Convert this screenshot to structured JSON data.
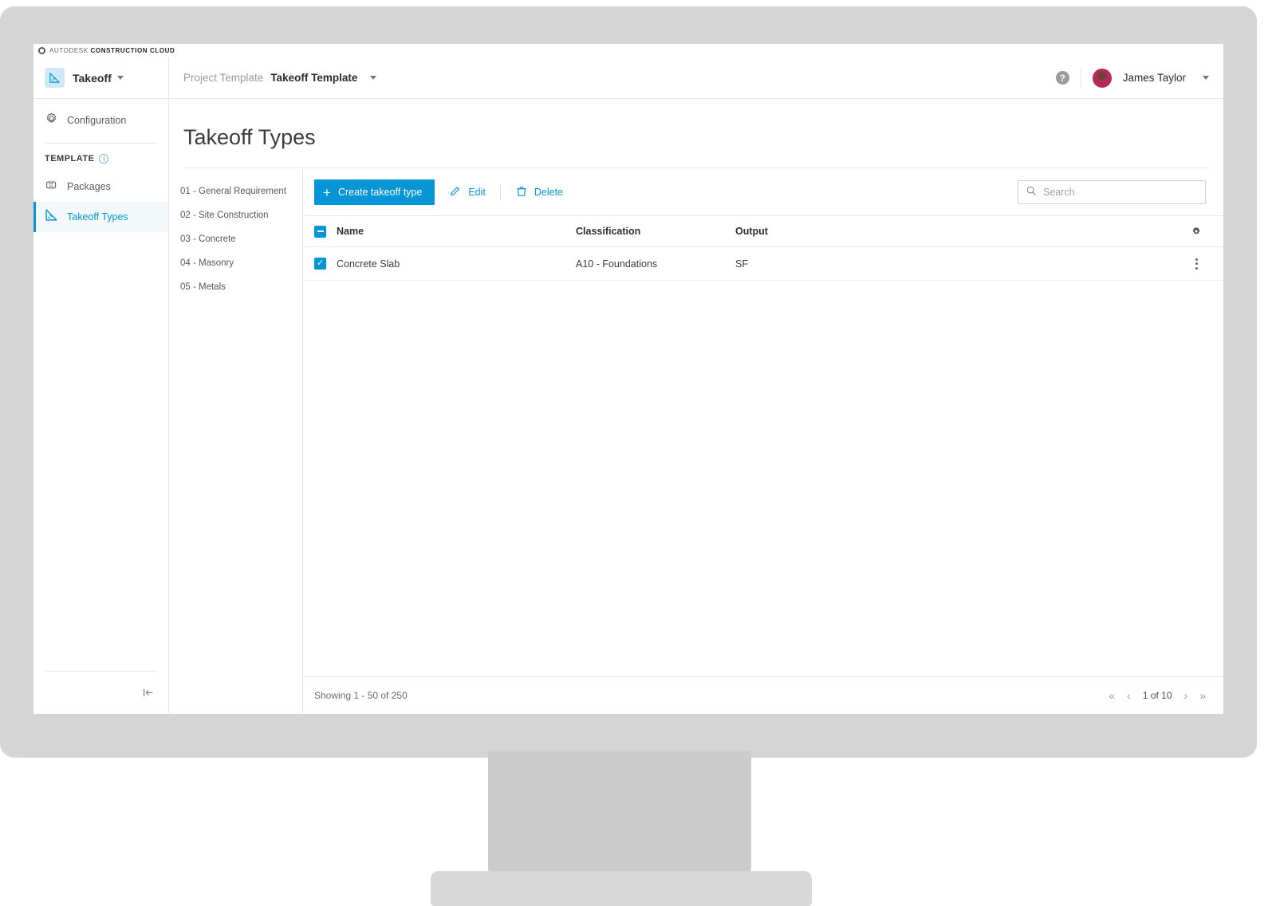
{
  "brand": {
    "prefix": "AUTODESK",
    "suffix": "CONSTRUCTION CLOUD"
  },
  "topbar": {
    "product_name": "Takeoff",
    "product_icon": "takeoff-ruler-icon",
    "breadcrumb": {
      "project": "Project Template",
      "template": "Takeoff Template"
    },
    "help_icon": "help-circle-icon",
    "help_glyph": "?",
    "user_name": "James Taylor",
    "avatar_icon": "user-avatar"
  },
  "sidebar": {
    "configuration": {
      "label": "Configuration",
      "icon": "gear-icon"
    },
    "section_label": "TEMPLATE",
    "section_info_icon": "info-icon",
    "section_info_glyph": "i",
    "items": [
      {
        "label": "Packages",
        "icon": "packages-icon",
        "active": false
      },
      {
        "label": "Takeoff Types",
        "icon": "takeoff-ruler-icon",
        "active": true
      }
    ],
    "collapse_icon": "collapse-panel-icon"
  },
  "main": {
    "page_title": "Takeoff Types",
    "categories": [
      "01 - General Requirement",
      "02 - Site Construction",
      "03 - Concrete",
      "04 - Masonry",
      "05 - Metals"
    ],
    "toolbar": {
      "create_label": "Create takeoff type",
      "create_icon": "plus-icon",
      "edit_label": "Edit",
      "edit_icon": "pencil-icon",
      "delete_label": "Delete",
      "delete_icon": "trash-icon"
    },
    "search": {
      "placeholder": "Search",
      "value": "",
      "icon": "search-icon"
    },
    "table": {
      "settings_icon": "gear-icon",
      "header_checkbox_state": "indeterminate",
      "columns": [
        "Name",
        "Classification",
        "Output"
      ],
      "rows": [
        {
          "checked": true,
          "name": "Concrete Slab",
          "classification": "A10 - Foundations",
          "output": "SF",
          "actions_icon": "kebab-menu-icon"
        }
      ]
    },
    "footer": {
      "showing": "Showing 1 - 50 of 250",
      "page_indicator": "1 of 10",
      "first_glyph": "«",
      "prev_glyph": "‹",
      "next_glyph": "›",
      "last_glyph": "»"
    }
  },
  "colors": {
    "accent": "#0696D7",
    "bezel": "#D5D5D5",
    "text": "#3C3C3C"
  }
}
